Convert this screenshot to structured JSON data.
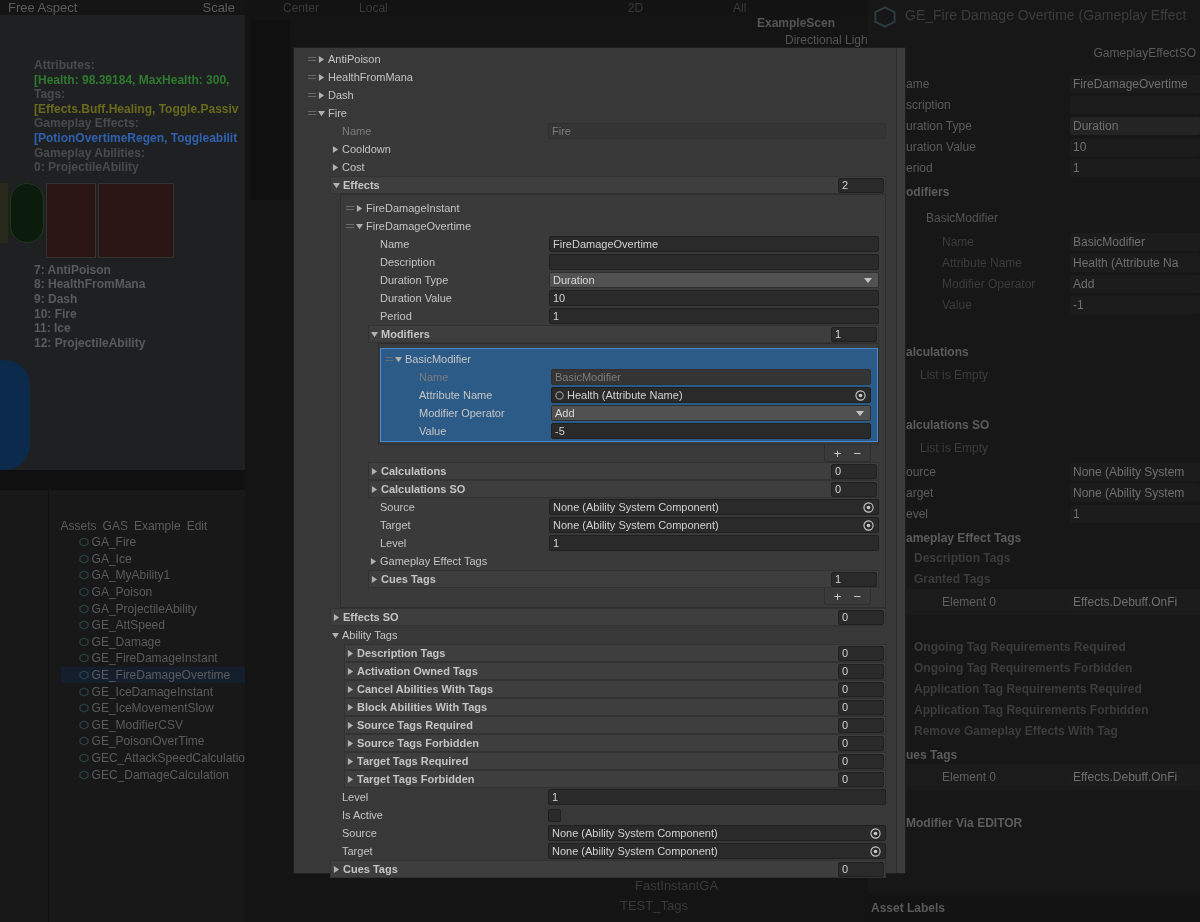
{
  "scene_view": {
    "aspect": "Free Aspect",
    "scale_label": "Scale",
    "stats": [
      {
        "text": "Attributes:",
        "color": "#4a4a4a"
      },
      {
        "text": "[Health: 98.39184, MaxHealth: 300, ",
        "color": "#2f7a2f"
      },
      {
        "text": "Tags:",
        "color": "#4a4a4a"
      },
      {
        "text": "[Effects.Buff.Healing, Toggle.Passiv",
        "color": "#6a6a1c"
      },
      {
        "text": "Gameplay Effects:",
        "color": "#4a4a4a"
      },
      {
        "text": "[PotionOvertimeRegen, Toggleabilit",
        "color": "#3060b0"
      },
      {
        "text": "Gameplay Abilities:",
        "color": "#4a4a4a"
      },
      {
        "text": "0: ProjectileAbility",
        "color": "#4a4a4a"
      }
    ],
    "abilities": [
      "7: AntiPoison",
      "8: HealthFromMana",
      "9: Dash",
      "10: Fire",
      "11: Ice",
      "12: ProjectileAbility"
    ]
  },
  "scene_toolbar": {
    "pivot": "Center",
    "space": "Local",
    "mode": "2D"
  },
  "hierarchy": {
    "search": "All",
    "scene": "ExampleScen",
    "items": [
      "Directional Ligh"
    ],
    "bottom_items": [
      "FastInstantGA",
      "TEST_Tags"
    ]
  },
  "project": {
    "breadcrumb": [
      "Assets",
      "GAS",
      "Example",
      "Edit"
    ],
    "files": [
      {
        "name": "GA_Fire",
        "selected": false
      },
      {
        "name": "GA_Ice",
        "selected": false
      },
      {
        "name": "GA_MyAbility1",
        "selected": false
      },
      {
        "name": "GA_Poison",
        "selected": false
      },
      {
        "name": "GA_ProjectileAbility",
        "selected": false
      },
      {
        "name": "GE_AttSpeed",
        "selected": false
      },
      {
        "name": "GE_Damage",
        "selected": false
      },
      {
        "name": "GE_FireDamageInstant",
        "selected": false
      },
      {
        "name": "GE_FireDamageOvertime",
        "selected": true
      },
      {
        "name": "GE_IceDamageInstant",
        "selected": false
      },
      {
        "name": "GE_IceMovementSlow",
        "selected": false
      },
      {
        "name": "GE_ModifierCSV",
        "selected": false
      },
      {
        "name": "GE_PoisonOverTime",
        "selected": false
      },
      {
        "name": "GEC_AttackSpeedCalculatio",
        "selected": false
      },
      {
        "name": "GEC_DamageCalculation",
        "selected": false
      }
    ]
  },
  "inspector": {
    "title": "GE_Fire Damage Overtime (Gameplay Effect",
    "script": "GameplayEffectSO",
    "footer": "Asset Labels",
    "rows": [
      {
        "kind": "field",
        "label": "ame",
        "value": "FireDamageOvertime"
      },
      {
        "kind": "field",
        "label": "scription"
      },
      {
        "kind": "dropdown",
        "label": "uration Type",
        "value": "Duration"
      },
      {
        "kind": "field",
        "label": "uration Value",
        "value": "10"
      },
      {
        "kind": "field",
        "label": "eriod",
        "value": "1"
      },
      {
        "kind": "header",
        "label": "odifiers"
      },
      {
        "kind": "element",
        "label": "BasicModifier"
      },
      {
        "kind": "subfield",
        "label": "Name",
        "value": "BasicModifier"
      },
      {
        "kind": "subfield",
        "label": "Attribute Name",
        "value": "Health (Attribute Na"
      },
      {
        "kind": "subfield",
        "label": "Modifier Operator",
        "value": "Add"
      },
      {
        "kind": "subfield",
        "label": "Value",
        "value": "-1"
      },
      {
        "kind": "section",
        "label": "alculations"
      },
      {
        "kind": "note",
        "label": "List is Empty"
      },
      {
        "kind": "section",
        "label": "alculations SO"
      },
      {
        "kind": "note",
        "label": "List is Empty"
      },
      {
        "kind": "field",
        "label": "ource",
        "value": "None (Ability System"
      },
      {
        "kind": "field",
        "label": "arget",
        "value": "None (Ability System"
      },
      {
        "kind": "field",
        "label": "evel",
        "value": "1"
      },
      {
        "kind": "header",
        "label": "ameplay Effect Tags"
      },
      {
        "kind": "subheader",
        "label": "Description Tags"
      },
      {
        "kind": "subheader",
        "label": "Granted Tags"
      },
      {
        "kind": "tag",
        "label": "Element 0",
        "value": "Effects.Debuff.OnFi"
      },
      {
        "kind": "subheader",
        "label": "Ongoing Tag Requirements Required"
      },
      {
        "kind": "subheader",
        "label": "Ongoing Tag Requirements Forbidden"
      },
      {
        "kind": "subheader",
        "label": "Application Tag Requirements Required"
      },
      {
        "kind": "subheader",
        "label": "Application Tag Requirements Forbidden"
      },
      {
        "kind": "subheader",
        "label": "Remove Gameplay Effects With Tag"
      },
      {
        "kind": "header",
        "label": "ues Tags"
      },
      {
        "kind": "tag",
        "label": "Element 0",
        "value": "Effects.Debuff.OnFi"
      },
      {
        "kind": "header",
        "label": "Modifier Via EDITOR"
      }
    ]
  },
  "popup": {
    "items": [
      {
        "kind": "item",
        "label": "AntiPoison",
        "expanded": false,
        "selected": false
      },
      {
        "kind": "item",
        "label": "HealthFromMana",
        "expanded": false,
        "selected": false
      },
      {
        "kind": "item",
        "label": "Dash",
        "expanded": false,
        "selected": false
      },
      {
        "kind": "item",
        "label": "Fire",
        "expanded": true,
        "selected": false,
        "children": [
          {
            "kind": "field",
            "label": "Name",
            "value": "Fire",
            "disabled": true
          },
          {
            "kind": "foldout",
            "label": "Cooldown",
            "expanded": false
          },
          {
            "kind": "foldout",
            "label": "Cost",
            "expanded": false
          },
          {
            "kind": "list",
            "label": "Effects",
            "count": "2",
            "expanded": true,
            "items": [
              {
                "kind": "item",
                "label": "FireDamageInstant",
                "expanded": false,
                "selected": false
              },
              {
                "kind": "item",
                "label": "FireDamageOvertime",
                "expanded": true,
                "selected": false,
                "children": [
                  {
                    "kind": "field",
                    "label": "Name",
                    "value": "FireDamageOvertime",
                    "disabled": false
                  },
                  {
                    "kind": "field",
                    "label": "Description",
                    "disabled": false
                  },
                  {
                    "kind": "dropdown",
                    "label": "Duration Type",
                    "value": "Duration"
                  },
                  {
                    "kind": "field",
                    "label": "Duration Value",
                    "value": "10",
                    "disabled": false
                  },
                  {
                    "kind": "field",
                    "label": "Period",
                    "value": "1",
                    "disabled": false
                  },
                  {
                    "kind": "list",
                    "label": "Modifiers",
                    "count": "1",
                    "expanded": true,
                    "add_button": "+",
                    "remove_button": "−",
                    "items": [
                      {
                        "kind": "item",
                        "label": "BasicModifier",
                        "expanded": true,
                        "selected": true,
                        "children": [
                          {
                            "kind": "field",
                            "label": "Name",
                            "value": "BasicModifier",
                            "disabled": true
                          },
                          {
                            "kind": "attribute",
                            "label": "Attribute Name",
                            "value": "Health (Attribute Name)"
                          },
                          {
                            "kind": "dropdown",
                            "label": "Modifier Operator",
                            "value": "Add"
                          },
                          {
                            "kind": "field",
                            "label": "Value",
                            "value": "-5",
                            "disabled": false
                          }
                        ]
                      }
                    ]
                  },
                  {
                    "kind": "list",
                    "label": "Calculations",
                    "count": "0",
                    "expanded": false
                  },
                  {
                    "kind": "list",
                    "label": "Calculations SO",
                    "count": "0",
                    "expanded": false
                  },
                  {
                    "kind": "object",
                    "label": "Source",
                    "value": "None (Ability System Component)"
                  },
                  {
                    "kind": "object",
                    "label": "Target",
                    "value": "None (Ability System Component)"
                  },
                  {
                    "kind": "field",
                    "label": "Level",
                    "value": "1",
                    "disabled": false
                  },
                  {
                    "kind": "foldout",
                    "label": "Gameplay Effect Tags",
                    "expanded": false
                  },
                  {
                    "kind": "list",
                    "label": "Cues Tags",
                    "count": "1",
                    "expanded": false,
                    "add_button": "+",
                    "remove_button": "−"
                  }
                ]
              }
            ]
          },
          {
            "kind": "list",
            "label": "Effects SO",
            "count": "0",
            "expanded": false
          },
          {
            "kind": "foldout",
            "label": "Ability Tags",
            "expanded": true,
            "children": [
              {
                "kind": "list",
                "label": "Description Tags",
                "count": "0",
                "expanded": false
              },
              {
                "kind": "list",
                "label": "Activation Owned Tags",
                "count": "0",
                "expanded": false
              },
              {
                "kind": "list",
                "label": "Cancel Abilities With Tags",
                "count": "0",
                "expanded": false
              },
              {
                "kind": "list",
                "label": "Block Abilities With Tags",
                "count": "0",
                "expanded": false
              },
              {
                "kind": "list",
                "label": "Source Tags Required",
                "count": "0",
                "expanded": false
              },
              {
                "kind": "list",
                "label": "Source Tags Forbidden",
                "count": "0",
                "expanded": false
              },
              {
                "kind": "list",
                "label": "Target Tags Required",
                "count": "0",
                "expanded": false
              },
              {
                "kind": "list",
                "label": "Target Tags Forbidden",
                "count": "0",
                "expanded": false
              }
            ]
          },
          {
            "kind": "field",
            "label": "Level",
            "value": "1",
            "disabled": false
          },
          {
            "kind": "checkbox",
            "label": "Is Active",
            "checked": false
          },
          {
            "kind": "object",
            "label": "Source",
            "value": "None (Ability System Component)"
          },
          {
            "kind": "object",
            "label": "Target",
            "value": "None (Ability System Component)"
          },
          {
            "kind": "list",
            "label": "Cues Tags",
            "count": "0",
            "expanded": false
          }
        ]
      }
    ]
  }
}
